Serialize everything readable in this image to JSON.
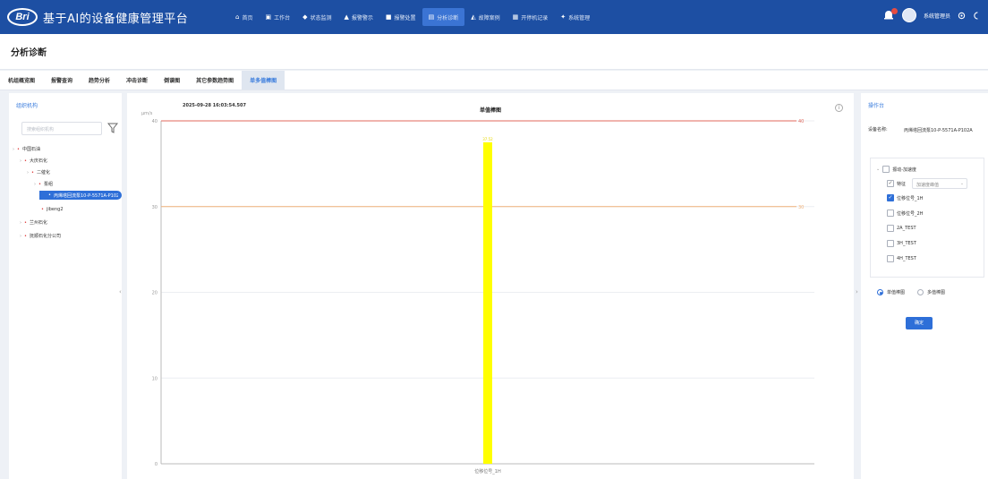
{
  "header": {
    "logo_text": "Bri",
    "app_title": "基于AI的设备健康管理平台",
    "nav": [
      {
        "label": "首页",
        "icon": "home-icon",
        "active": false
      },
      {
        "label": "工作台",
        "icon": "workbench-icon",
        "active": false
      },
      {
        "label": "状态监测",
        "icon": "shield-icon",
        "active": false
      },
      {
        "label": "报警警示",
        "icon": "alarm-icon",
        "active": false
      },
      {
        "label": "报警处置",
        "icon": "report-icon",
        "active": false
      },
      {
        "label": "分析诊断",
        "icon": "analysis-icon",
        "active": true
      },
      {
        "label": "故障案例",
        "icon": "case-icon",
        "active": false
      },
      {
        "label": "开停机记录",
        "icon": "record-icon",
        "active": false
      },
      {
        "label": "系统管理",
        "icon": "users-icon",
        "active": false
      }
    ],
    "user": "系统管理员"
  },
  "page": {
    "title": "分析诊断"
  },
  "tabs": [
    "机组概览图",
    "报警查询",
    "趋势分析",
    "冲击诊断",
    "倒谱图",
    "其它参数趋势图",
    "单多值棒图"
  ],
  "active_tab": 6,
  "left": {
    "title": "组织机构",
    "search_placeholder": "搜索组织机构",
    "tree": [
      {
        "label": "中国石油",
        "level": 0
      },
      {
        "label": "大庆石化",
        "level": 1
      },
      {
        "label": "二催化",
        "level": 2
      },
      {
        "label": "泵组",
        "level": 3
      },
      {
        "label": "丙烯塔回流泵10-P-5571A-P102A",
        "level": 4,
        "selected": true
      },
      {
        "label": "jibeng2",
        "level": 4
      },
      {
        "label": "兰州石化",
        "level": 1
      },
      {
        "label": "抚顺石化分公司",
        "level": 1
      }
    ]
  },
  "chart_panel": {
    "timestamp": "2025-09-28 16:03:54.507",
    "info_glyph": "i"
  },
  "chart_data": {
    "type": "bar",
    "title": "单值棒图",
    "ylabel": "μm/s",
    "categories": [
      "位移位号_1H"
    ],
    "values": [
      37.5
    ],
    "bar_label": "37.52",
    "ylim": [
      0,
      40
    ],
    "yticks": [
      0,
      10,
      20,
      30,
      40
    ],
    "thresholds": [
      {
        "value": 40,
        "label": "40",
        "color": "#e06a5e"
      },
      {
        "value": 30,
        "label": "30",
        "color": "#f0b27a"
      }
    ],
    "bar_color": "#ffff00",
    "grid": true
  },
  "right": {
    "title": "操作台",
    "device_label": "设备名称:",
    "device_value": "丙烯塔回流泵10-P-5571A-P102A",
    "group_label": "振动-加速度",
    "feature_label": "特征",
    "feature_select": "加速度峰值",
    "channels": [
      {
        "label": "位移位号_1H",
        "checked": true
      },
      {
        "label": "位移位号_2H",
        "checked": false
      },
      {
        "label": "2A_TEST",
        "checked": false
      },
      {
        "label": "3H_TEST",
        "checked": false
      },
      {
        "label": "4H_TEST",
        "checked": false
      }
    ],
    "radio_single": "单值棒图",
    "radio_multi": "多值棒图",
    "confirm": "确定"
  }
}
